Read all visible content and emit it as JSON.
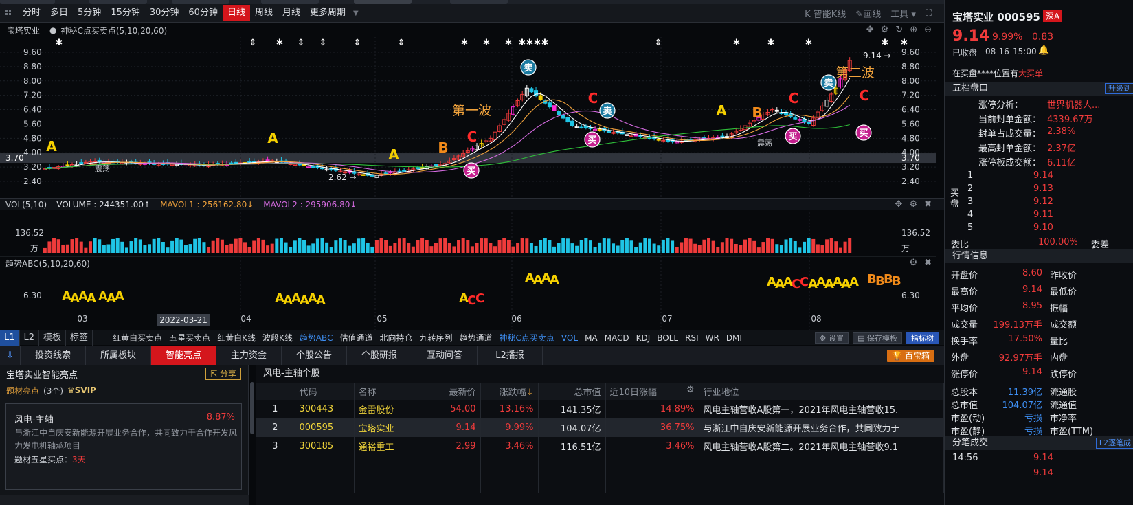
{
  "period_bar": {
    "items": [
      "分时",
      "多日",
      "5分钟",
      "15分钟",
      "30分钟",
      "60分钟",
      "日线",
      "周线",
      "月线",
      "更多周期"
    ],
    "active": "日线",
    "right_tools": [
      "智能K线",
      "画线",
      "工具"
    ]
  },
  "chart_header": {
    "stock": "宝塔实业",
    "indicator": "神秘C点买卖点(5,10,20,60)"
  },
  "kline": {
    "price_ticks": [
      "9.60",
      "8.80",
      "8.00",
      "7.20",
      "6.40",
      "5.60",
      "4.80",
      "4.00",
      "3.20",
      "2.40"
    ],
    "current_price_label": "3.70",
    "high_label": "9.14",
    "low_label": "2.62",
    "wave1": "第一波",
    "wave2": "第二波",
    "zhendang": "震荡",
    "x_labels": [
      "03",
      "04",
      "05",
      "06",
      "07",
      "08"
    ],
    "date_cursor": "2022-03-21",
    "buy": "买",
    "sell": "卖",
    "letters": {
      "A": "A",
      "B": "B",
      "C": "C"
    }
  },
  "vol": {
    "label": "VOL(5,10)",
    "volume": "VOLUME : 244351.00↑",
    "mavol1": "MAVOL1 : 256162.80↓",
    "mavol2": "MAVOL2 : 295906.80↓",
    "tick": "136.52",
    "unit": "万"
  },
  "abc": {
    "label": "趋势ABC(5,10,20,60)",
    "tick": "6.30"
  },
  "indicator_row": {
    "left_tabs": [
      "L1",
      "L2",
      "模板",
      "标签"
    ],
    "items": [
      "红黄白买卖点",
      "五星买卖点",
      "红黄白K线",
      "波段K线",
      "趋势ABC",
      "估值通道",
      "北向持仓",
      "九转序列",
      "趋势通道",
      "神秘C点买卖点",
      "VOL",
      "MA",
      "MACD",
      "KDJ",
      "BOLL",
      "RSI",
      "WR",
      "DMI"
    ],
    "buttons": [
      "设置",
      "保存模板",
      "指标树"
    ]
  },
  "bottom_tabs": {
    "items": [
      "投资线索",
      "所属板块",
      "智能亮点",
      "主力资金",
      "个股公告",
      "个股研报",
      "互动问答",
      "L2播报"
    ],
    "active": "智能亮点",
    "baibao": "百宝箱"
  },
  "left_panel": {
    "title": "宝塔实业智能亮点",
    "share": "分享",
    "tag": "题材亮点",
    "count": "(3个)",
    "svip": "SVIP",
    "card_title": "风电-主轴",
    "card_pct": "8.87%",
    "card_desc": "与浙江中自庆安新能源开展业务合作，共同致力于合作开发风力发电机轴承项目",
    "card_star_label": "题材五星买点：",
    "card_star_val": "3天"
  },
  "table_panel": {
    "title": "风电-主轴个股",
    "headers": [
      "代码",
      "名称",
      "最新价",
      "涨跌幅",
      "总市值",
      "近10日涨幅",
      "行业地位"
    ],
    "rows": [
      {
        "idx": "1",
        "code": "300443",
        "name": "金雷股份",
        "price": "54.00",
        "chg": "13.16%",
        "cap": "141.35亿",
        "chg10": "14.89%",
        "desc": "风电主轴营收A股第一，2021年风电主轴营收15."
      },
      {
        "idx": "2",
        "code": "000595",
        "name": "宝塔实业",
        "price": "9.14",
        "chg": "9.99%",
        "cap": "104.07亿",
        "chg10": "36.75%",
        "desc": "与浙江中自庆安新能源开展业务合作，共同致力于"
      },
      {
        "idx": "3",
        "code": "300185",
        "name": "通裕重工",
        "price": "2.99",
        "chg": "3.46%",
        "cap": "116.51亿",
        "chg10": "3.46%",
        "desc": "风电主轴营收A股第二。2021年风电主轴营收9.1"
      }
    ]
  },
  "right_panel": {
    "name": "宝塔实业 000595",
    "market": "深A",
    "price": "9.14",
    "pct": "9.99%",
    "chg": "0.83",
    "status": "已收盘",
    "date": "08-16",
    "time": "15:00",
    "buy_note": "在买盘****位置有",
    "buy_note2": "大买单",
    "five_title": "五档盘口",
    "upgrade": "升级到",
    "zt": [
      {
        "k": "涨停分析：",
        "v": "世界机器人..."
      },
      {
        "k": "当前封单金额：",
        "v": "4339.67万"
      },
      {
        "k": "封单占成交量：",
        "v": "2.38%"
      },
      {
        "k": "最高封单金额：",
        "v": "2.37亿"
      },
      {
        "k": "涨停板成交额：",
        "v": "6.11亿"
      }
    ],
    "buy_label": "买盘",
    "bids": [
      {
        "n": "1",
        "p": "9.14"
      },
      {
        "n": "2",
        "p": "9.13"
      },
      {
        "n": "3",
        "p": "9.12"
      },
      {
        "n": "4",
        "p": "9.11"
      },
      {
        "n": "5",
        "p": "9.10"
      }
    ],
    "weibi_label": "委比",
    "weibi": "100.00%",
    "weicha": "委差",
    "quote_title": "行情信息",
    "quotes": [
      {
        "k": "开盘价",
        "v": "8.60",
        "k2": "昨收价"
      },
      {
        "k": "最高价",
        "v": "9.14",
        "k2": "最低价"
      },
      {
        "k": "平均价",
        "v": "8.95",
        "k2": "振幅"
      },
      {
        "k": "成交量",
        "v": "199.13万手",
        "k2": "成交额"
      },
      {
        "k": "换手率",
        "v": "17.50%",
        "k2": "量比"
      },
      {
        "k": "外盘",
        "v": "92.97万手",
        "k2": "内盘"
      },
      {
        "k": "涨停价",
        "v": "9.14",
        "k2": "跌停价"
      }
    ],
    "fund": [
      {
        "k": "总股本",
        "v": "11.39亿",
        "k2": "流通股"
      },
      {
        "k": "总市值",
        "v": "104.07亿",
        "k2": "流通值"
      },
      {
        "k": "市盈(动)",
        "v": "亏损",
        "k2": "市净率"
      },
      {
        "k": "市盈(静)",
        "v": "亏损",
        "k2": "市盈(TTM)"
      }
    ],
    "tick_title": "分笔成交",
    "tick_btn": "L2逐笔成",
    "ticks": [
      {
        "t": "14:56",
        "p": "9.14"
      },
      {
        "t": "",
        "p": "9.14"
      }
    ]
  },
  "colors": {
    "up": "#ef3b3b",
    "down": "#1fc5e6",
    "accent": "#d4161c",
    "ma5": "#ffffff",
    "ma10": "#f0a23c",
    "ma20": "#d46be0",
    "ma60": "#2fbf3a"
  }
}
